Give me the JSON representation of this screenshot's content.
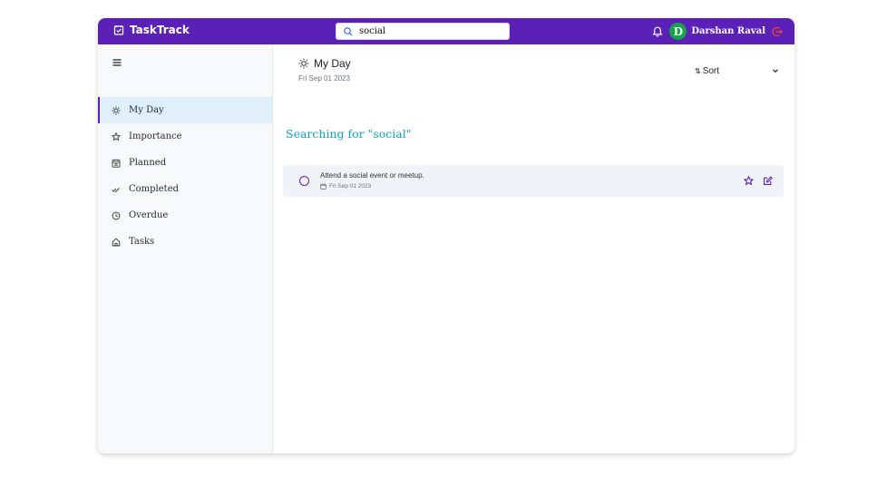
{
  "header": {
    "app_name": "TaskTrack",
    "search": {
      "value": "social",
      "placeholder": ""
    },
    "user": {
      "initial": "D",
      "name": "Darshan Raval"
    },
    "icons": [
      "tasktrack-logo-icon",
      "search-icon",
      "bell-icon",
      "logout-icon"
    ],
    "colors": {
      "header_bg": "#5b21b6",
      "avatar_bg": "#16a34a",
      "logout": "#ef4444"
    }
  },
  "sidebar": {
    "menu_icon": "hamburger-icon",
    "items": [
      {
        "label": "My Day",
        "icon": "sun-icon",
        "active": true
      },
      {
        "label": "Importance",
        "icon": "star-icon",
        "active": false
      },
      {
        "label": "Planned",
        "icon": "calendar-icon",
        "active": false
      },
      {
        "label": "Completed",
        "icon": "check-double-icon",
        "active": false
      },
      {
        "label": "Overdue",
        "icon": "clock-icon",
        "active": false
      },
      {
        "label": "Tasks",
        "icon": "home-icon",
        "active": false
      }
    ]
  },
  "main": {
    "title": "My Day",
    "date": "Fri Sep 01 2023",
    "sort_label": "Sort",
    "search_heading": "Searching for \"social\"",
    "tasks": [
      {
        "title": "Attend a social event or meetup.",
        "date": "Fri Sep 01 2023",
        "completed": false
      }
    ],
    "colors": {
      "accent": "#5b21b6",
      "search_heading": "#0ea5c9",
      "active_nav_bg": "#dff0fb"
    }
  }
}
